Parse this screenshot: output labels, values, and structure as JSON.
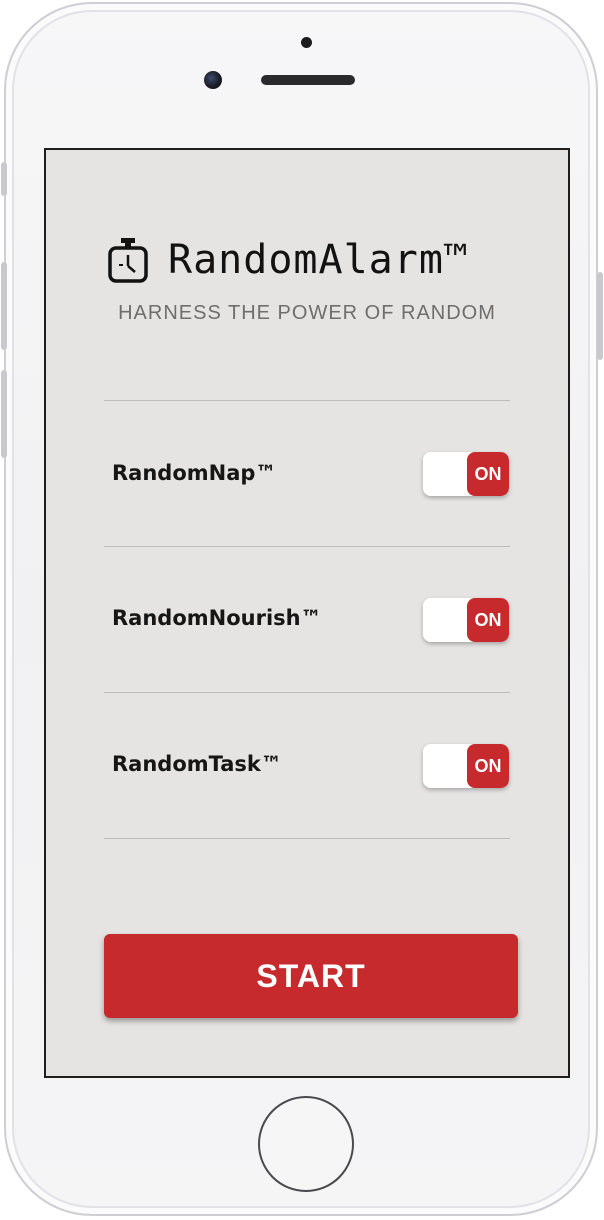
{
  "app": {
    "title": "RandomAlarm™",
    "tagline": "HARNESS THE POWER OF RANDOM",
    "icon": "stopwatch-icon"
  },
  "settings": [
    {
      "label": "RandomNap™",
      "toggle_state": "ON",
      "enabled": true
    },
    {
      "label": "RandomNourish™",
      "toggle_state": "ON",
      "enabled": true
    },
    {
      "label": "RandomTask™",
      "toggle_state": "ON",
      "enabled": true
    }
  ],
  "start_button": {
    "label": "START"
  },
  "colors": {
    "accent": "#c62a2d",
    "screen_background": "#e6e4e3",
    "text": "#161616",
    "tagline": "#6e6e6e"
  }
}
